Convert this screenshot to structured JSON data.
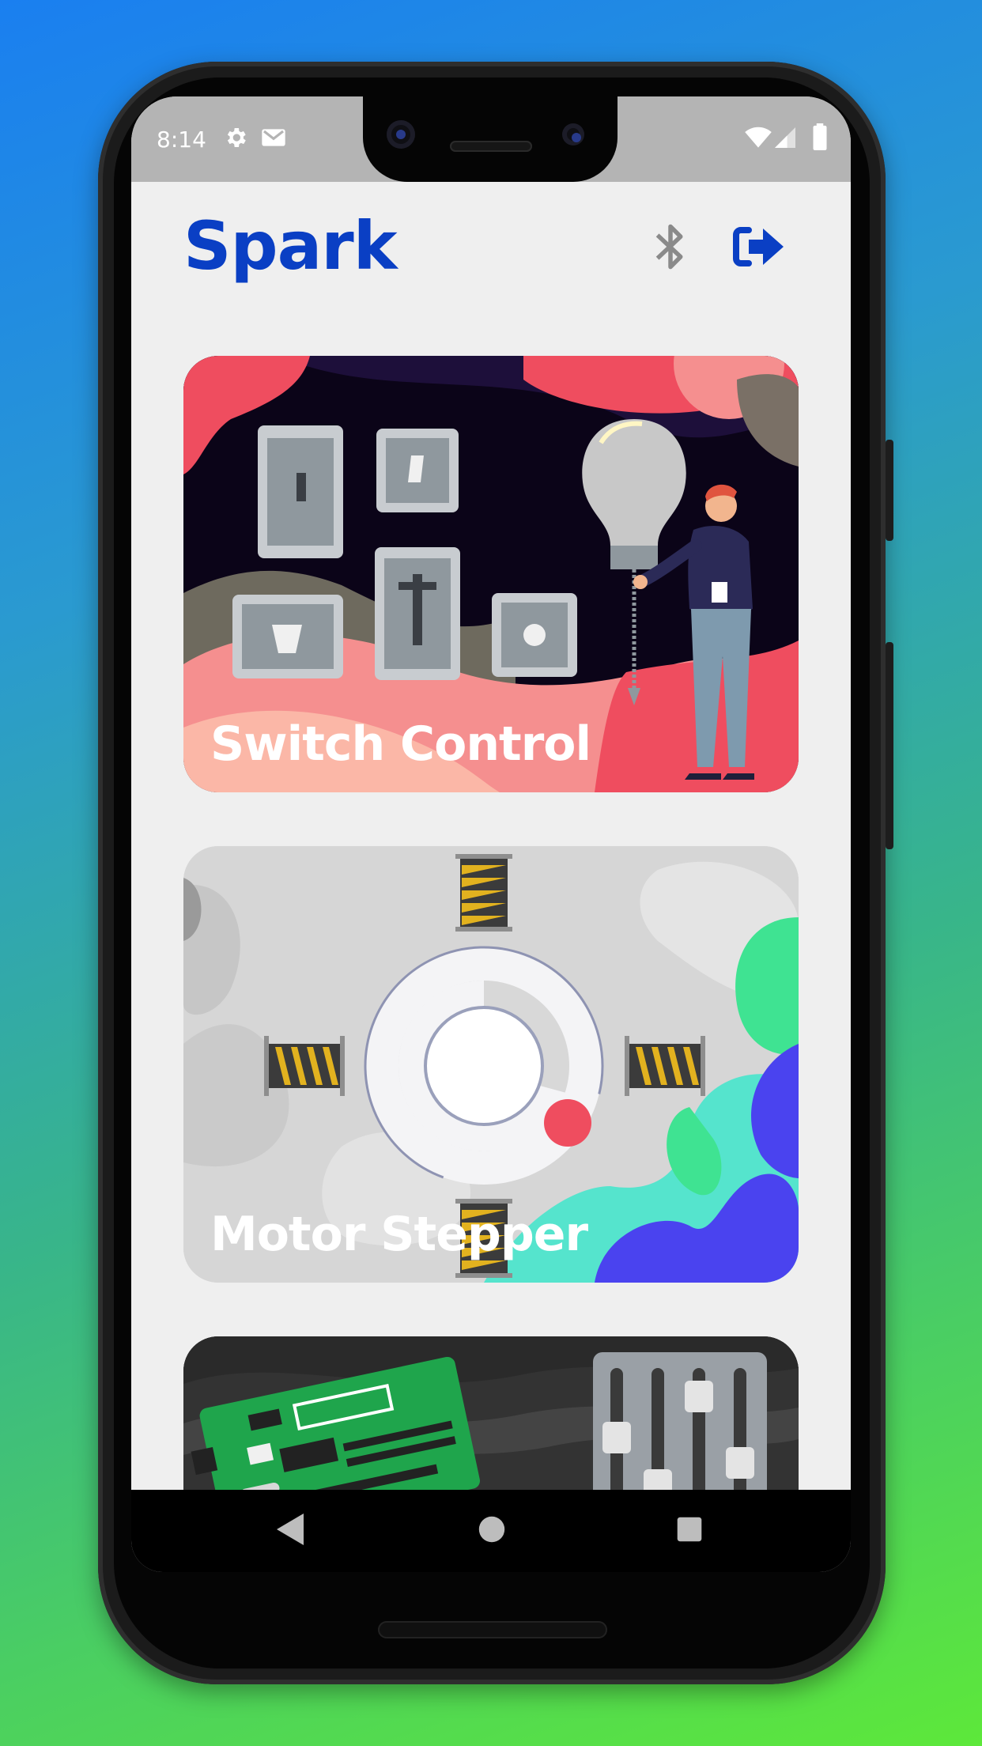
{
  "status_bar": {
    "time": "8:14",
    "left_icons": [
      "settings-icon",
      "mail-icon"
    ],
    "right_icons": [
      "wifi-icon",
      "cell-signal-icon",
      "battery-icon"
    ]
  },
  "header": {
    "title": "Spark",
    "title_color": "#0a3fc4",
    "actions": [
      {
        "name": "bluetooth-icon",
        "color": "#8a8a8a"
      },
      {
        "name": "logout-icon",
        "color": "#0a3fc4"
      }
    ]
  },
  "cards": [
    {
      "label": "Switch Control",
      "illustration": "light-switches-and-bulb"
    },
    {
      "label": "Motor Stepper",
      "illustration": "stepper-motor"
    },
    {
      "label": "",
      "illustration": "arduino-board-and-sliders"
    }
  ],
  "nav_bar": {
    "buttons": [
      "back-icon",
      "home-icon",
      "recents-icon"
    ]
  },
  "colors": {
    "screen_bg": "#efefef",
    "status_bar_bg": "#b4b4b4"
  }
}
